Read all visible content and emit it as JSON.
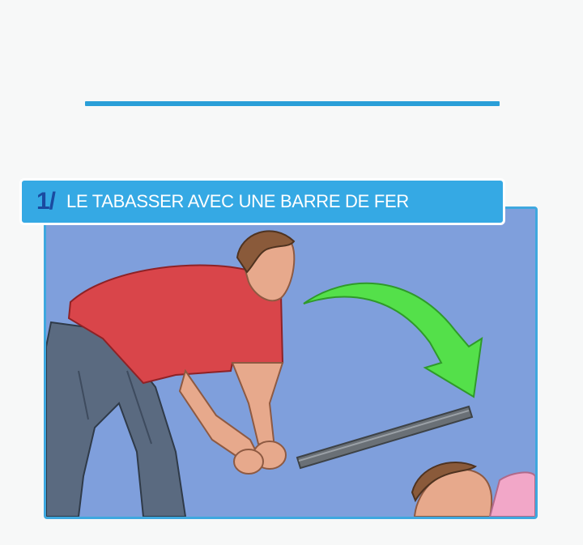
{
  "step": {
    "number": "1/",
    "title": "LE TABASSER AVEC UNE BARRE DE FER"
  },
  "colors": {
    "accent_line": "#2a9fd8",
    "banner": "#35a9e4",
    "number": "#1a4aa0",
    "panel_background": "#7f9fdc",
    "arrow": "#54e04a"
  },
  "illustration": {
    "figures": [
      "standing-man-red-shirt",
      "lying-person"
    ],
    "props": [
      "iron-bar",
      "curved-arrow"
    ]
  }
}
